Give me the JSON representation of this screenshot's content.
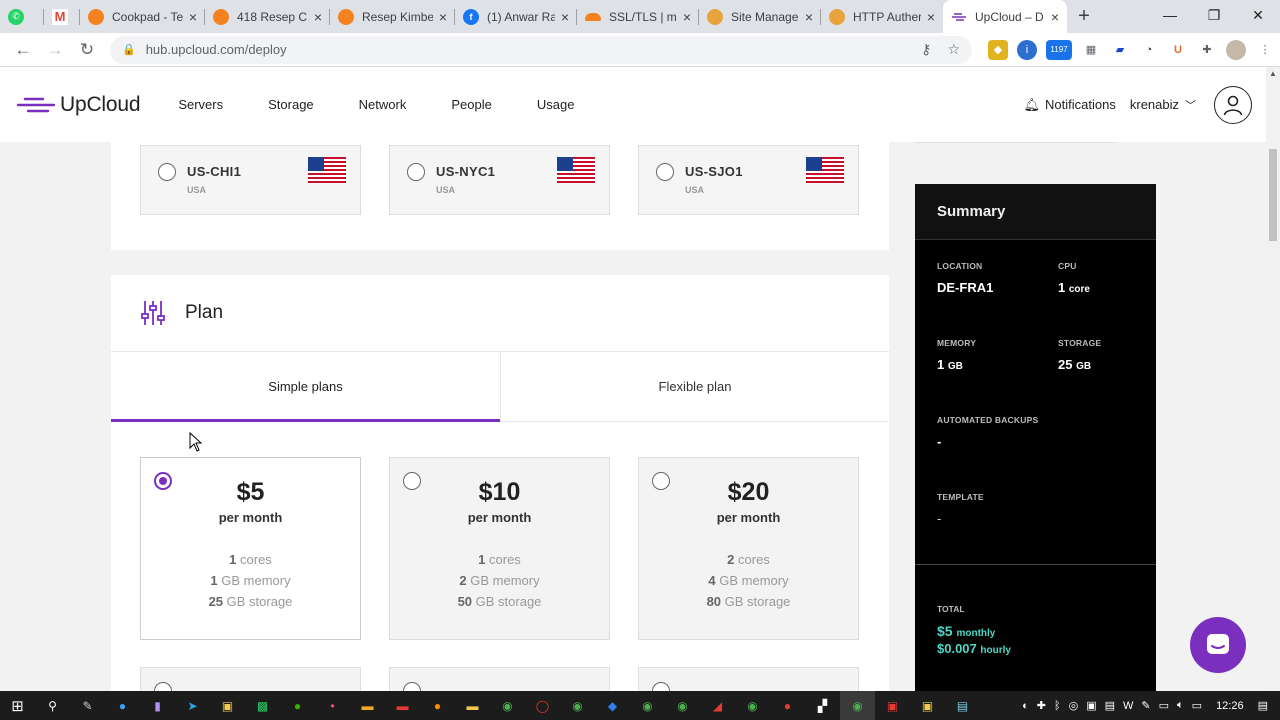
{
  "browser": {
    "tabs": [
      {
        "title": "",
        "icon": "whatsapp-icon",
        "color": "#25d366"
      },
      {
        "title": "",
        "icon": "gmail-icon",
        "color": "#ea4335"
      },
      {
        "title": "Cookpad - Te",
        "icon": "cookpad-icon",
        "color": "#f58220"
      },
      {
        "title": "418 Resep C",
        "icon": "cookpad-icon",
        "color": "#f58220"
      },
      {
        "title": "Resep Kimbe",
        "icon": "cookpad-icon",
        "color": "#f58220"
      },
      {
        "title": "(1) Anwar Ra",
        "icon": "facebook-icon",
        "color": "#1877f2"
      },
      {
        "title": "SSL/TLS | ma",
        "icon": "cloudflare-icon",
        "color": "#f48120"
      },
      {
        "title": "Site Manage",
        "icon": "site-icon",
        "color": "#e8a33d"
      },
      {
        "title": "HTTP Auther",
        "icon": "site-icon",
        "color": "#e8a33d"
      },
      {
        "title": "UpCloud – D",
        "icon": "upcloud-icon",
        "color": "#7b2fbe"
      }
    ],
    "url": "hub.upcloud.com/deploy",
    "ext_badge": "1197"
  },
  "header": {
    "brand": "UpCloud",
    "nav": [
      "Servers",
      "Storage",
      "Network",
      "People",
      "Usage"
    ],
    "notifications": "Notifications",
    "username": "krenabiz"
  },
  "locations": [
    {
      "code": "US-CHI1",
      "country": "USA"
    },
    {
      "code": "US-NYC1",
      "country": "USA"
    },
    {
      "code": "US-SJO1",
      "country": "USA"
    }
  ],
  "plan": {
    "title": "Plan",
    "tabs": [
      "Simple plans",
      "Flexible plan"
    ],
    "options": [
      {
        "price": "$5",
        "period": "per month",
        "cores": "1",
        "cores_label": " cores",
        "memory": "1",
        "memory_label": " GB memory",
        "storage": "25",
        "storage_label": " GB storage",
        "selected": true
      },
      {
        "price": "$10",
        "period": "per month",
        "cores": "1",
        "cores_label": " cores",
        "memory": "2",
        "memory_label": " GB memory",
        "storage": "50",
        "storage_label": " GB storage",
        "selected": false
      },
      {
        "price": "$20",
        "period": "per month",
        "cores": "2",
        "cores_label": " cores",
        "memory": "4",
        "memory_label": " GB memory",
        "storage": "80",
        "storage_label": " GB storage",
        "selected": false
      }
    ]
  },
  "summary": {
    "title": "Summary",
    "location_label": "LOCATION",
    "location": "DE-FRA1",
    "cpu_label": "CPU",
    "cpu": "1",
    "cpu_unit": "core",
    "memory_label": "MEMORY",
    "memory": "1",
    "memory_unit": "GB",
    "storage_label": "STORAGE",
    "storage": "25",
    "storage_unit": "GB",
    "backups_label": "AUTOMATED BACKUPS",
    "backups": "-",
    "template_label": "TEMPLATE",
    "template": "-",
    "total_label": "TOTAL",
    "monthly": "$5",
    "monthly_unit": "monthly",
    "hourly": "$0.007",
    "hourly_unit": "hourly"
  },
  "taskbar": {
    "time": "12:26"
  },
  "colors": {
    "accent": "#7b2fbe",
    "total": "#4fd6c7"
  }
}
